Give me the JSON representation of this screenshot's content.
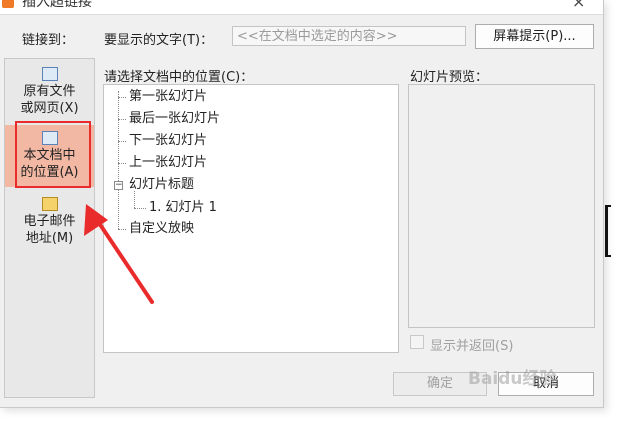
{
  "window": {
    "title": "插入超链接",
    "close_glyph": "×"
  },
  "link_to_label": "链接到：",
  "display_text": {
    "label": "要显示的文字(T)：",
    "value": "<<在文档中选定的内容>>"
  },
  "screentip_button": "屏幕提示(P)...",
  "sidebar": {
    "items": [
      {
        "line1": "原有文件",
        "line2": "或网页(X)",
        "icon": "web-page-icon"
      },
      {
        "line1": "本文档中",
        "line2": "的位置(A)",
        "icon": "document-place-icon",
        "selected": true
      },
      {
        "line1": "电子邮件",
        "line2": "地址(M)",
        "icon": "email-icon"
      }
    ]
  },
  "tree": {
    "label": "请选择文档中的位置(C)：",
    "items": [
      "第一张幻灯片",
      "最后一张幻灯片",
      "下一张幻灯片",
      "上一张幻灯片",
      "幻灯片标题",
      "1. 幻灯片 1",
      "自定义放映"
    ],
    "expander_glyph": "−"
  },
  "preview": {
    "label": "幻灯片预览："
  },
  "show_return": {
    "label": "显示并返回(S)",
    "checked": false
  },
  "buttons": {
    "ok": "确定",
    "cancel": "取消"
  },
  "watermark": "Baidu经验",
  "colors": {
    "highlight": "#f3b8a4",
    "annotation_red": "#ea2b2b",
    "brand_orange": "#f07a26"
  }
}
